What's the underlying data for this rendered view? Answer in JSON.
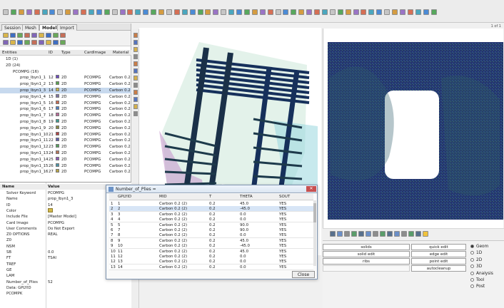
{
  "app": {
    "page_indicator": "1 of 1"
  },
  "tabs": [
    "Session",
    "Mesh",
    "Model",
    "Import"
  ],
  "active_tab": "Model",
  "entities_table": {
    "headers": [
      "Entities",
      "ID",
      "Type",
      "CardImage",
      "Material"
    ],
    "rows": [
      {
        "name": "1D (1)",
        "id": "",
        "color": "",
        "type": "",
        "card": "",
        "mat": ""
      },
      {
        "name": "2D (24)",
        "id": "",
        "color": "",
        "type": "",
        "card": "",
        "mat": ""
      },
      {
        "name": "PCOMPG (16)",
        "id": "",
        "color": "",
        "type": "",
        "card": "",
        "mat": ""
      },
      {
        "name": "prop_lbyn1_1",
        "id": "12",
        "color": "#6e4cc1",
        "type": "2D",
        "card": "PCOMPG",
        "mat": "Carbon 0.2"
      },
      {
        "name": "prop_lbyn1_2",
        "id": "13",
        "color": "#5aa552",
        "type": "2D",
        "card": "PCOMPG",
        "mat": "Carbon 0.2"
      },
      {
        "name": "prop_lbyn1_3",
        "id": "14",
        "color": "#c6b44b",
        "type": "2D",
        "card": "PCOMPG",
        "mat": "Carbon 0.2"
      },
      {
        "name": "prop_lbyn1_4",
        "id": "15",
        "color": "#7e74a5",
        "type": "2D",
        "card": "PCOMPG",
        "mat": "Carbon 0.2"
      },
      {
        "name": "prop_lbyn1_5",
        "id": "16",
        "color": "#c96b51",
        "type": "2D",
        "card": "PCOMPG",
        "mat": "Carbon 0.2"
      },
      {
        "name": "prop_lbyn1_6",
        "id": "17",
        "color": "#4e7fc2",
        "type": "2D",
        "card": "PCOMPG",
        "mat": "Carbon 0.2"
      },
      {
        "name": "prop_lbyn1_7",
        "id": "18",
        "color": "#bb6a9a",
        "type": "2D",
        "card": "PCOMPG",
        "mat": "Carbon 0.2"
      },
      {
        "name": "prop_lbyn1_8",
        "id": "19",
        "color": "#3f9c91",
        "type": "2D",
        "card": "PCOMPG",
        "mat": "Carbon 0.2"
      },
      {
        "name": "prop_lbyn1_9",
        "id": "20",
        "color": "#8c8c46",
        "type": "2D",
        "card": "PCOMPG",
        "mat": "Carbon 0.2"
      },
      {
        "name": "prop_lbyn1_10",
        "id": "21",
        "color": "#b34545",
        "type": "2D",
        "card": "PCOMPG",
        "mat": "Carbon 0.2"
      },
      {
        "name": "prop_lbyn1_11",
        "id": "22",
        "color": "#5f5fb0",
        "type": "2D",
        "card": "PCOMPG",
        "mat": "Carbon 0.2"
      },
      {
        "name": "prop_lbyn1_12",
        "id": "23",
        "color": "#57a15d",
        "type": "2D",
        "card": "PCOMPG",
        "mat": "Carbon 0.2"
      },
      {
        "name": "prop_lbyn1_13",
        "id": "24",
        "color": "#b9785a",
        "type": "2D",
        "card": "PCOMPG",
        "mat": "Carbon 0.2"
      },
      {
        "name": "prop_lbyn1_14",
        "id": "25",
        "color": "#8f59b6",
        "type": "2D",
        "card": "PCOMPG",
        "mat": "Carbon 0.2"
      },
      {
        "name": "prop_lbyn1_15",
        "id": "26",
        "color": "#4d96a7",
        "type": "2D",
        "card": "PCOMPG",
        "mat": "Carbon 0.2"
      },
      {
        "name": "prop_lbyn1_16",
        "id": "27",
        "color": "#b8a449",
        "type": "2D",
        "card": "PCOMPG",
        "mat": "Carbon 0.2"
      }
    ],
    "selected_row": "prop_lbyn1_3"
  },
  "properties": {
    "headers": [
      "Name",
      "Value"
    ],
    "rows": [
      {
        "name": "Solver Keyword",
        "value": "PCOMPG"
      },
      {
        "name": "Name",
        "value": "prop_lbyn1_3"
      },
      {
        "name": "ID",
        "value": "14"
      },
      {
        "name": "Color",
        "value": ""
      },
      {
        "name": "Include File",
        "value": "[Master Model]"
      },
      {
        "name": "Card Image",
        "value": "PCOMPG"
      },
      {
        "name": "User Comments",
        "value": "Do Not Export"
      },
      {
        "name": "Z0 OPTIONS",
        "value": "REAL"
      },
      {
        "name": "Z0",
        "value": ""
      },
      {
        "name": "NSM",
        "value": ""
      },
      {
        "name": "SB",
        "value": "0.0"
      },
      {
        "name": "FT",
        "value": "TSAI"
      },
      {
        "name": "TREF",
        "value": ""
      },
      {
        "name": "GE",
        "value": ""
      },
      {
        "name": "LAM",
        "value": ""
      },
      {
        "name": "Number_of_Plies",
        "value": "52"
      },
      {
        "name": "Data: GPLYID",
        "value": ""
      },
      {
        "name": "PCOMPK",
        "value": ""
      }
    ]
  },
  "dialog": {
    "title": "Number_of_Plies =",
    "close_label": "Close",
    "headers": [
      "",
      "GPLYID",
      "MID",
      "T",
      "THETA",
      "SOUT"
    ],
    "rows": [
      {
        "n": "1",
        "gplyid": "1",
        "mid": "Carbon 0.2 (2)",
        "t": "0.2",
        "theta": "45.0",
        "sout": "YES"
      },
      {
        "n": "2",
        "gplyid": "2",
        "mid": "Carbon 0.2 (2)",
        "t": "0.2",
        "theta": "-45.0",
        "sout": "YES"
      },
      {
        "n": "3",
        "gplyid": "3",
        "mid": "Carbon 0.2 (2)",
        "t": "0.2",
        "theta": "0.0",
        "sout": "YES"
      },
      {
        "n": "4",
        "gplyid": "4",
        "mid": "Carbon 0.2 (2)",
        "t": "0.2",
        "theta": "0.0",
        "sout": "YES"
      },
      {
        "n": "5",
        "gplyid": "5",
        "mid": "Carbon 0.2 (2)",
        "t": "0.2",
        "theta": "90.0",
        "sout": "YES"
      },
      {
        "n": "6",
        "gplyid": "7",
        "mid": "Carbon 0.2 (2)",
        "t": "0.2",
        "theta": "90.0",
        "sout": "YES"
      },
      {
        "n": "7",
        "gplyid": "8",
        "mid": "Carbon 0.2 (2)",
        "t": "0.2",
        "theta": "0.0",
        "sout": "YES"
      },
      {
        "n": "8",
        "gplyid": "9",
        "mid": "Carbon 0.2 (2)",
        "t": "0.2",
        "theta": "45.0",
        "sout": "YES"
      },
      {
        "n": "9",
        "gplyid": "10",
        "mid": "Carbon 0.2 (2)",
        "t": "0.2",
        "theta": "-45.0",
        "sout": "YES"
      },
      {
        "n": "10",
        "gplyid": "11",
        "mid": "Carbon 0.2 (2)",
        "t": "0.2",
        "theta": "45.0",
        "sout": "YES"
      },
      {
        "n": "11",
        "gplyid": "12",
        "mid": "Carbon 0.2 (2)",
        "t": "0.2",
        "theta": "0.0",
        "sout": "YES"
      },
      {
        "n": "12",
        "gplyid": "13",
        "mid": "Carbon 0.2 (2)",
        "t": "0.2",
        "theta": "0.0",
        "sout": "YES"
      },
      {
        "n": "13",
        "gplyid": "14",
        "mid": "Carbon 0.2 (2)",
        "t": "0.2",
        "theta": "0.0",
        "sout": "YES"
      }
    ]
  },
  "panel": {
    "buttons": [
      "solids",
      "quick edit",
      "solid edit",
      "edge edit",
      "ribs",
      "point edit",
      "",
      "autocleanup"
    ],
    "radios": [
      "Geom",
      "1D",
      "2D",
      "3D",
      "Analysis",
      "Tool",
      "Post"
    ],
    "selected_radio": "Geom"
  },
  "colors": {
    "background": "#f2f2f2",
    "accent": "#1a3e7a",
    "model_blue": "#16305b",
    "model_green": "#3f8a67",
    "model_pink": "#c9a2cf"
  }
}
